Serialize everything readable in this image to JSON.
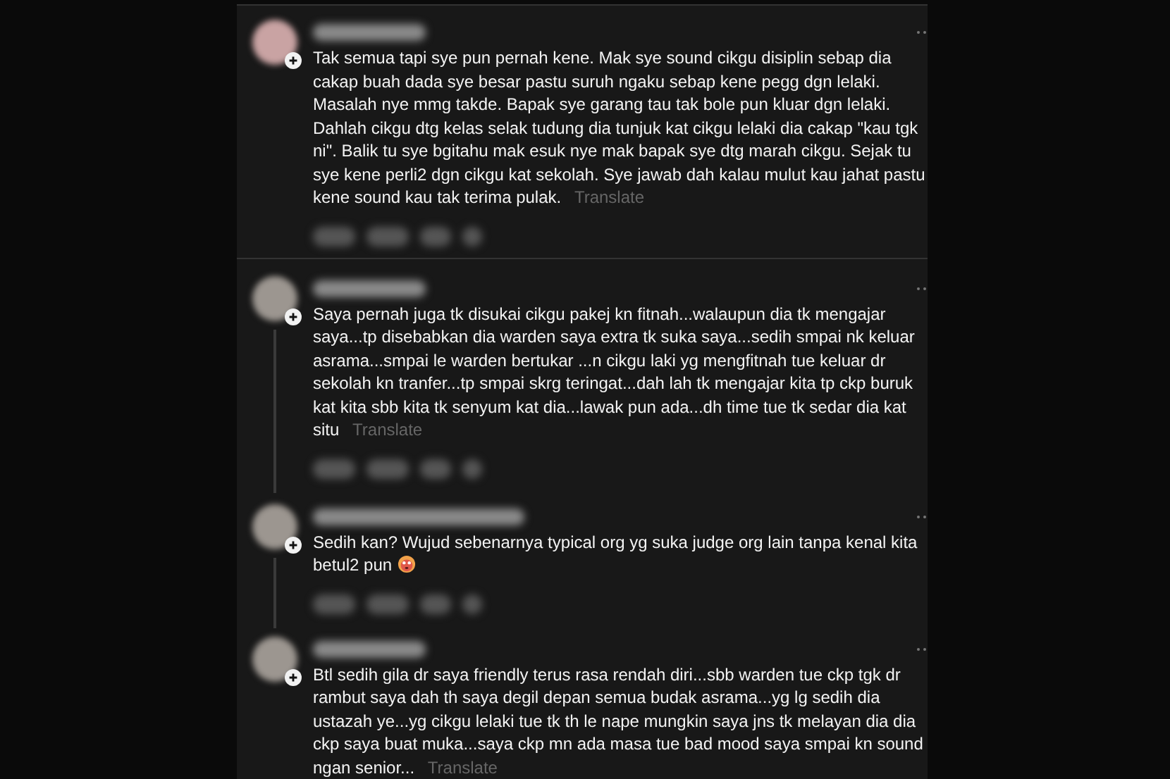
{
  "comments": [
    {
      "text": "Tak semua tapi sye pun pernah kene. Mak sye sound cikgu disiplin sebap dia cakap buah dada sye besar pastu suruh ngaku sebap kene pegg dgn lelaki. Masalah nye mmg takde. Bapak sye garang tau tak bole pun kluar dgn lelaki. Dahlah cikgu dtg kelas selak tudung dia tunjuk kat cikgu lelaki dia cakap \"kau tgk ni\". Balik tu sye bgitahu mak esuk nye mak bapak sye dtg marah cikgu. Sejak tu sye kene perli2 dgn cikgu kat sekolah. Sye jawab dah kalau mulut kau jahat pastu kene sound kau tak terima pulak.",
      "translate": "Translate",
      "emoji": false,
      "thread_line": false
    },
    {
      "text": "Saya pernah juga tk disukai cikgu pakej kn fitnah...walaupun dia tk mengajar saya...tp disebabkan dia warden saya extra tk suka saya...sedih smpai nk keluar asrama...smpai le warden bertukar ...n cikgu laki yg mengfitnah tue keluar dr sekolah kn tranfer...tp smpai skrg teringat...dah lah tk mengajar kita tp ckp buruk kat kita sbb kita tk senyum kat dia...lawak pun ada...dh time tue tk sedar dia kat situ",
      "translate": "Translate",
      "emoji": false,
      "thread_line": true
    },
    {
      "text": "Sedih kan? Wujud sebenarnya typical org yg suka judge org lain tanpa kenal kita betul2 pun",
      "emoji": true,
      "thread_line": true
    },
    {
      "text": "Btl sedih gila dr saya friendly terus rasa rendah diri...sbb warden tue ckp tgk dr rambut saya dah th saya degil depan semua budak asrama...yg lg sedih dia ustazah ye...yg cikgu lelaki tue tk th le nape mungkin saya jns tk melayan dia dia ckp saya buat muka...saya ckp mn ada masa tue bad mood saya smpai kn sound ngan senior...",
      "translate": "Translate",
      "emoji": false,
      "thread_line": false
    }
  ]
}
